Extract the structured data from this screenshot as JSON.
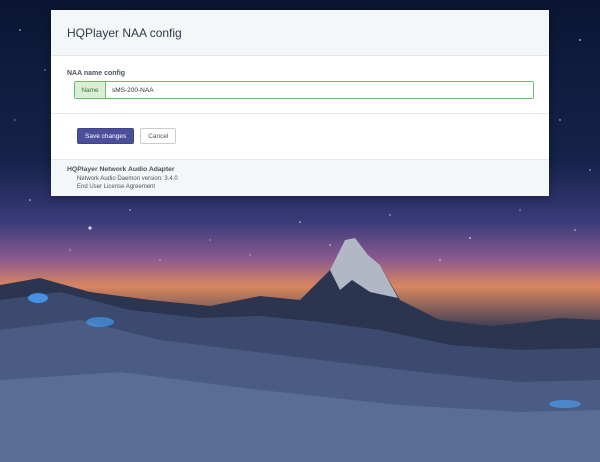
{
  "header": {
    "title": "HQPlayer NAA config"
  },
  "form": {
    "section_label": "NAA name config",
    "name_addon": "Name",
    "name_value": "sMS-200-NAA"
  },
  "actions": {
    "save_label": "Save changes",
    "cancel_label": "Cancel"
  },
  "footer": {
    "title": "HQPlayer Network Audio Adapter",
    "version_line": "Network Audio Daemon version: 3.4.0",
    "eula_line": "End User License Agreement"
  },
  "colors": {
    "primary_button": "#4a4f9c",
    "input_border_success": "#6bbf6b"
  }
}
